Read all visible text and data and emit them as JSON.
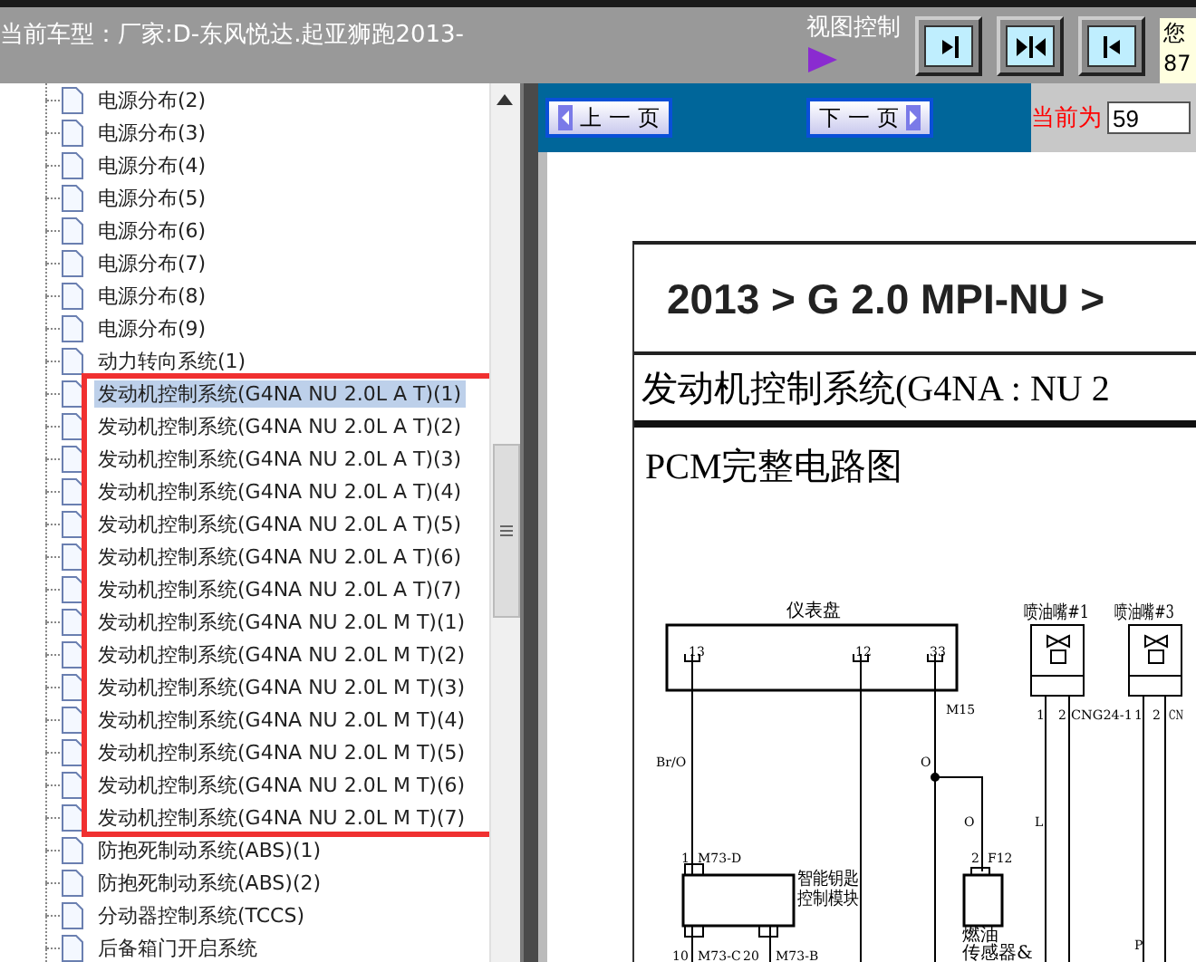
{
  "header": {
    "model_label": "当前车型：厂家:D-东风悦达.起亚狮跑2013-",
    "view_control_label": "视图控制",
    "user_info": [
      "您",
      "87"
    ]
  },
  "tree": {
    "items": [
      {
        "kind": "item",
        "label": "电源分布(2)",
        "selected": false
      },
      {
        "kind": "item",
        "label": "电源分布(3)",
        "selected": false
      },
      {
        "kind": "item",
        "label": "电源分布(4)",
        "selected": false
      },
      {
        "kind": "item",
        "label": "电源分布(5)",
        "selected": false
      },
      {
        "kind": "item",
        "label": "电源分布(6)",
        "selected": false
      },
      {
        "kind": "item",
        "label": "电源分布(7)",
        "selected": false
      },
      {
        "kind": "item",
        "label": "电源分布(8)",
        "selected": false
      },
      {
        "kind": "item",
        "label": "电源分布(9)",
        "selected": false
      },
      {
        "kind": "item",
        "label": "动力转向系统(1)",
        "selected": false
      },
      {
        "kind": "framed_group",
        "items": [
          {
            "label": "发动机控制系统(G4NA NU 2.0L A T)(1)",
            "selected": true
          },
          {
            "label": "发动机控制系统(G4NA NU 2.0L A T)(2)",
            "selected": false
          },
          {
            "label": "发动机控制系统(G4NA NU 2.0L A T)(3)",
            "selected": false
          },
          {
            "label": "发动机控制系统(G4NA NU 2.0L A T)(4)",
            "selected": false
          },
          {
            "label": "发动机控制系统(G4NA NU 2.0L A T)(5)",
            "selected": false
          },
          {
            "label": "发动机控制系统(G4NA NU 2.0L A T)(6)",
            "selected": false
          },
          {
            "label": "发动机控制系统(G4NA NU 2.0L A T)(7)",
            "selected": false
          },
          {
            "label": "发动机控制系统(G4NA NU 2.0L M T)(1)",
            "selected": false
          },
          {
            "label": "发动机控制系统(G4NA NU 2.0L M T)(2)",
            "selected": false
          },
          {
            "label": "发动机控制系统(G4NA NU 2.0L M T)(3)",
            "selected": false
          },
          {
            "label": "发动机控制系统(G4NA NU 2.0L M T)(4)",
            "selected": false
          },
          {
            "label": "发动机控制系统(G4NA NU 2.0L M T)(5)",
            "selected": false
          },
          {
            "label": "发动机控制系统(G4NA NU 2.0L M T)(6)",
            "selected": false
          },
          {
            "label": "发动机控制系统(G4NA NU 2.0L M T)(7)",
            "selected": false
          }
        ]
      },
      {
        "kind": "item",
        "label": "防抱死制动系统(ABS)(1)",
        "selected": false
      },
      {
        "kind": "item",
        "label": "防抱死制动系统(ABS)(2)",
        "selected": false
      },
      {
        "kind": "item",
        "label": "分动器控制系统(TCCS)",
        "selected": false
      },
      {
        "kind": "item",
        "label": "后备箱门开启系统",
        "selected": false
      }
    ]
  },
  "nav": {
    "prev": "上 一 页",
    "next": "下 一 页",
    "current_label": "当前为",
    "current_page": "59"
  },
  "document": {
    "heading": "2013 > G 2.0 MPI-NU >",
    "section": "发动机控制系统(G4NA : NU 2",
    "subtitle": "PCM完整电路图",
    "diagram_labels": [
      "仪表盘",
      "喷油嘴#1",
      "喷油嘴#3",
      "13",
      "12",
      "33",
      "M15",
      "1",
      "2",
      "CNG24-1",
      "1",
      "2",
      "CN",
      "Br/O",
      "O",
      "O",
      "L",
      "1",
      "M73-D",
      "2",
      "F12",
      "智能钥匙",
      "控制模块",
      "燃油",
      "传感器&",
      "P",
      "10",
      "M73-C",
      "20",
      "M73-B"
    ]
  }
}
